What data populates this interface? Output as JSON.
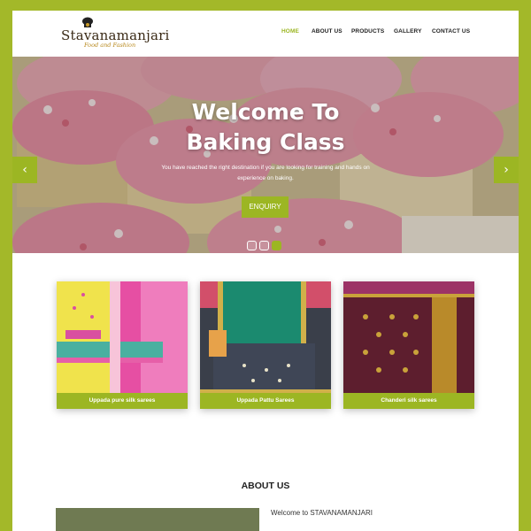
{
  "brand": {
    "name": "Stavanamanjari",
    "tagline": "Food and Fashion"
  },
  "nav": {
    "items": [
      {
        "label": "HOME",
        "active": true
      },
      {
        "label": "ABOUT US",
        "active": false
      },
      {
        "label": "PRODUCTS",
        "active": false
      },
      {
        "label": "GALLERY",
        "active": false
      },
      {
        "label": "CONTACT US",
        "active": false
      }
    ]
  },
  "hero": {
    "title_line1": "Welcome To",
    "title_line2": "Baking Class",
    "subtitle": "You have reached the right destination if you are looking for training and hands on experience on baking.",
    "button_label": "ENQUIRY",
    "prev_icon": "chevron-left-icon",
    "next_icon": "chevron-right-icon",
    "slide_count": 3,
    "active_slide": 3
  },
  "products": [
    {
      "label": "Uppada pure silk sarees"
    },
    {
      "label": "Uppada Pattu Sarees"
    },
    {
      "label": "Chanderi silk sarees"
    }
  ],
  "about": {
    "title": "ABOUT US",
    "intro": "Welcome to STAVANAMANJARI"
  },
  "colors": {
    "accent": "#9cb623",
    "frame": "#a3b829",
    "text": "#222222"
  }
}
